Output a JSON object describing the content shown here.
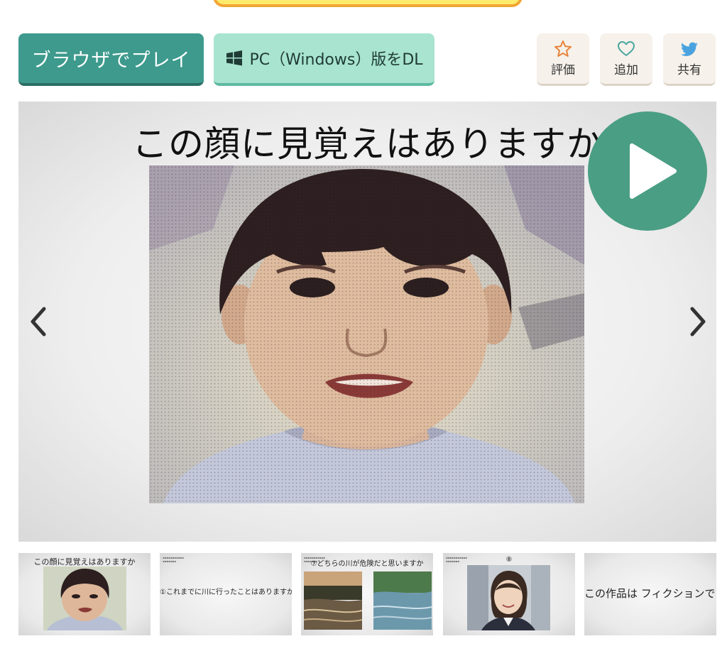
{
  "actions": {
    "play_browser_label": "ブラウザでプレイ",
    "download_label": "PC（Windows）版をDL",
    "rate_label": "評価",
    "add_label": "追加",
    "share_label": "共有"
  },
  "viewer": {
    "slide_title": "この顔に見覚えはありますか"
  },
  "thumbnails": [
    {
      "title": "この顔に見覚えはありますか"
    },
    {
      "title": "①これまでに川に行ったことはありますか"
    },
    {
      "title": "⑦どちらの川が危険だと思いますか"
    },
    {
      "title": "⑧"
    },
    {
      "title": "この作品は フィクションです"
    }
  ],
  "icons": {
    "windows": "windows-icon",
    "rate": "star-icon",
    "add": "heart-icon",
    "share": "twitter-bird-icon",
    "play": "play-icon",
    "prev": "chevron-left-icon",
    "next": "chevron-right-icon"
  },
  "colors": {
    "primary_button": "#3d9a8d",
    "secondary_button": "#a8e4cf",
    "play_circle": "#4a9e83",
    "banner_fill": "#fdeb6b",
    "banner_border": "#f2a533",
    "star_icon": "#e8833a",
    "heart_icon": "#4aa5a0",
    "twitter_icon": "#4aa3df"
  }
}
